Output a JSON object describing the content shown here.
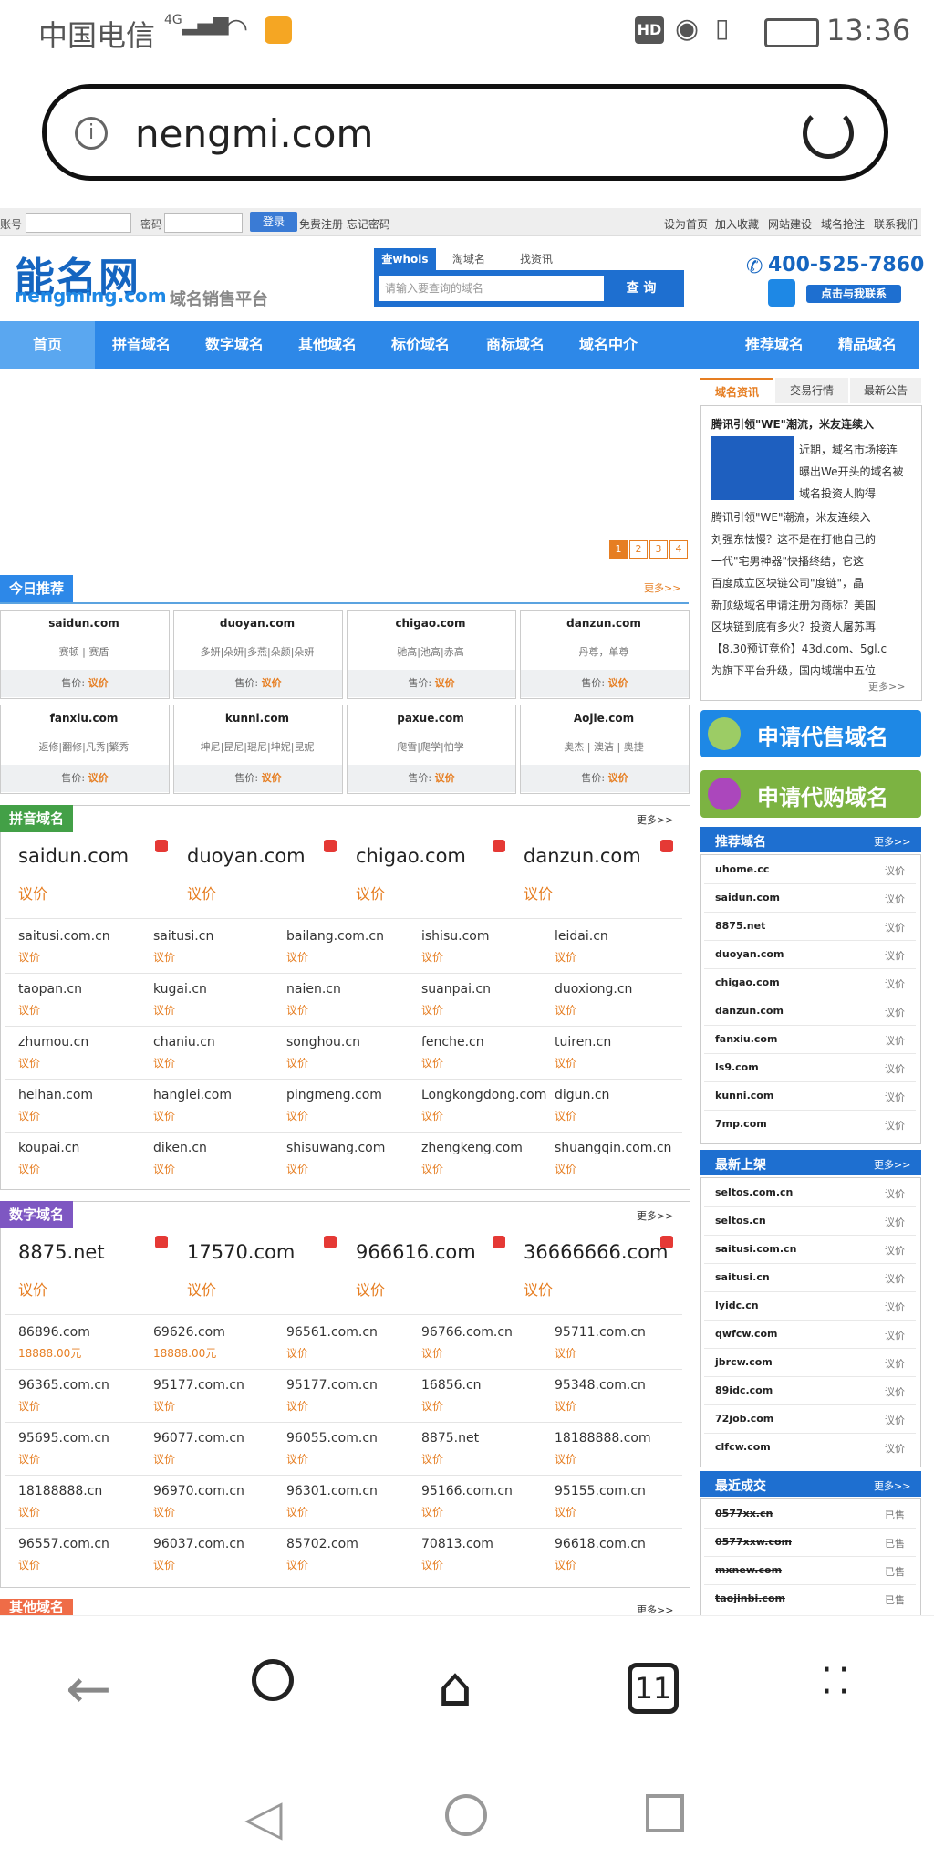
{
  "status_bar": {
    "carrier": "中国电信",
    "network": "4G",
    "time": "13:36",
    "hd": "HD"
  },
  "url_bar": {
    "url": "nengmi.com"
  },
  "top_strip": {
    "account_label": "账号",
    "password_label": "密码",
    "login_button": "登录",
    "register_links": "免费注册 忘记密码",
    "links": [
      "设为首页",
      "加入收藏",
      "网站建设",
      "域名抢注",
      "联系我们"
    ]
  },
  "header": {
    "logo_text": "能名网",
    "logo_domain": "nengming.com",
    "tagline": "域名销售平台",
    "search_tabs": [
      "查whois",
      "淘域名",
      "找资讯"
    ],
    "search_placeholder": "请输入要查询的域名",
    "search_button": "查 询",
    "phone": "400-525-7860",
    "contact_button": "点击与我联系"
  },
  "nav": {
    "items": [
      "首页",
      "拼音域名",
      "数字域名",
      "其他域名",
      "标价域名",
      "商标域名",
      "域名中介",
      "推荐域名",
      "精品域名"
    ]
  },
  "banner": {
    "pages": [
      "1",
      "2",
      "3",
      "4"
    ]
  },
  "today": {
    "title": "今日推荐",
    "more": "更多>>",
    "price_label": "售价:",
    "price_value": "议价",
    "cards": [
      {
        "domain": "saidun.com",
        "desc": "赛顿 | 赛盾"
      },
      {
        "domain": "duoyan.com",
        "desc": "多妍|朵妍|多燕|朵颜|朵妍"
      },
      {
        "domain": "chigao.com",
        "desc": "驰高|池高|赤高"
      },
      {
        "domain": "danzun.com",
        "desc": "丹尊，单尊"
      },
      {
        "domain": "fanxiu.com",
        "desc": "返修|翻修|凡秀|繁秀"
      },
      {
        "domain": "kunni.com",
        "desc": "坤尼|昆尼|琨尼|坤妮|昆妮"
      },
      {
        "domain": "paxue.com",
        "desc": "爬雪|爬学|怕学"
      },
      {
        "domain": "Aojie.com",
        "desc": "奥杰 | 澳洁 | 奥捷"
      }
    ]
  },
  "pinyin": {
    "title": "拼音域名",
    "more": "更多>>",
    "price": "议价",
    "featured": [
      "saidun.com",
      "duoyan.com",
      "chigao.com",
      "danzun.com"
    ],
    "grid": [
      [
        "saitusi.com.cn",
        "saitusi.cn",
        "bailang.com.cn",
        "ishisu.com",
        "leidai.cn"
      ],
      [
        "taopan.cn",
        "kugai.cn",
        "naien.cn",
        "suanpai.cn",
        "duoxiong.cn"
      ],
      [
        "zhumou.cn",
        "chaniu.cn",
        "songhou.cn",
        "fenche.cn",
        "tuiren.cn"
      ],
      [
        "heihan.com",
        "hanglei.com",
        "pingmeng.com",
        "Longkongdong.com",
        "digun.cn"
      ],
      [
        "koupai.cn",
        "diken.cn",
        "shisuwang.com",
        "zhengkeng.com",
        "shuangqin.com.cn"
      ]
    ]
  },
  "shuzi": {
    "title": "数字域名",
    "more": "更多>>",
    "price": "议价",
    "featured": [
      "8875.net",
      "17570.com",
      "966616.com",
      "36666666.com"
    ],
    "grid": [
      [
        {
          "d": "86896.com",
          "p": "18888.00元"
        },
        {
          "d": "69626.com",
          "p": "18888.00元"
        },
        {
          "d": "96561.com.cn",
          "p": "议价"
        },
        {
          "d": "96766.com.cn",
          "p": "议价"
        },
        {
          "d": "95711.com.cn",
          "p": "议价"
        }
      ],
      [
        {
          "d": "96365.com.cn",
          "p": "议价"
        },
        {
          "d": "95177.com.cn",
          "p": "议价"
        },
        {
          "d": "95177.com.cn",
          "p": "议价"
        },
        {
          "d": "16856.cn",
          "p": "议价"
        },
        {
          "d": "95348.com.cn",
          "p": "议价"
        }
      ],
      [
        {
          "d": "95695.com.cn",
          "p": "议价"
        },
        {
          "d": "96077.com.cn",
          "p": "议价"
        },
        {
          "d": "96055.com.cn",
          "p": "议价"
        },
        {
          "d": "8875.net",
          "p": "议价"
        },
        {
          "d": "18188888.com",
          "p": "议价"
        }
      ],
      [
        {
          "d": "18188888.cn",
          "p": "议价"
        },
        {
          "d": "96970.com.cn",
          "p": "议价"
        },
        {
          "d": "96301.com.cn",
          "p": "议价"
        },
        {
          "d": "95166.com.cn",
          "p": "议价"
        },
        {
          "d": "95155.com.cn",
          "p": "议价"
        }
      ],
      [
        {
          "d": "96557.com.cn",
          "p": "议价"
        },
        {
          "d": "96037.com.cn",
          "p": "议价"
        },
        {
          "d": "85702.com",
          "p": "议价"
        },
        {
          "d": "70813.com",
          "p": "议价"
        },
        {
          "d": "96618.com.cn",
          "p": "议价"
        }
      ]
    ]
  },
  "next_section": {
    "title": "其他域名",
    "more": "更多>>"
  },
  "sidebar": {
    "tabs": [
      "域名资讯",
      "交易行情",
      "最新公告"
    ],
    "news_title": "腾讯引领\"WE\"潮流，米友连续入",
    "news_lines_right": [
      "近期，域名市场接连",
      "曝出We开头的域名被",
      "域名投资人购得"
    ],
    "news_lines": [
      "腾讯引领\"WE\"潮流，米友连续入",
      "刘强东怯慢？这不是在打他自己的",
      "一代\"宅男神器\"快播终结，它这",
      "百度成立区块链公司\"度链\"，晶",
      "新顶级域名申请注册为商标？美国",
      "区块链到底有多火？投资人屠苏再",
      "【8.30预订竞价】43d.com、5gl.c",
      "为旗下平台升级，国内域端中五位"
    ],
    "news_more": "更多>>",
    "sell_button": "申请代售域名",
    "buy_button": "申请代购域名",
    "recommend": {
      "title": "推荐域名",
      "more": "更多>>",
      "price": "议价",
      "items": [
        "uhome.cc",
        "saidun.com",
        "8875.net",
        "duoyan.com",
        "chigao.com",
        "danzun.com",
        "fanxiu.com",
        "ls9.com",
        "kunni.com",
        "7mp.com"
      ]
    },
    "latest": {
      "title": "最新上架",
      "more": "更多>>",
      "price": "议价",
      "items": [
        "seltos.com.cn",
        "seltos.cn",
        "saitusi.com.cn",
        "saitusi.cn",
        "lyidc.cn",
        "qwfcw.com",
        "jbrcw.com",
        "89idc.com",
        "72job.com",
        "clfcw.com"
      ]
    },
    "deals": {
      "title": "最近成交",
      "more": "更多>>",
      "status": "已售",
      "items": [
        "0577xx.cn",
        "0577xxw.com",
        "mxnew.com",
        "taojinbi.com"
      ]
    }
  },
  "browser_nav": {
    "tab_count": "11"
  },
  "colors": {
    "brand_blue": "#2d88e8",
    "accent_orange": "#e67e22"
  }
}
